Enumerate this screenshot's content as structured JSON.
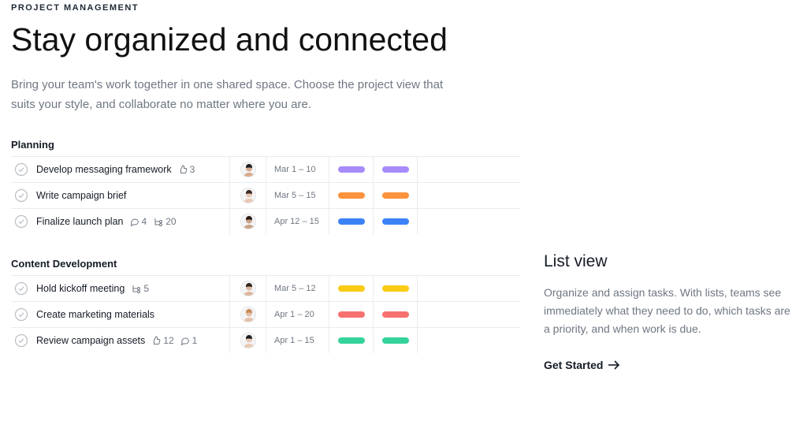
{
  "eyebrow": "PROJECT MANAGEMENT",
  "title": "Stay organized and connected",
  "subtitle": "Bring your team's work together in one shared space. Choose the project view that suits your style, and collaborate no matter where you are.",
  "sections": [
    {
      "header": "Planning",
      "rows": [
        {
          "name": "Develop messaging framework",
          "metas": [
            {
              "icon": "like",
              "count": "3"
            }
          ],
          "avatar": {
            "skin": "#d9a98c",
            "hair": "#1c1c1c"
          },
          "dates": "Mar 1 – 10",
          "pill": "#a78bfa"
        },
        {
          "name": "Write campaign brief",
          "metas": [],
          "avatar": {
            "skin": "#e8c7b3",
            "hair": "#3b2a20"
          },
          "dates": "Mar 5 – 15",
          "pill": "#fb923c"
        },
        {
          "name": "Finalize launch plan",
          "metas": [
            {
              "icon": "comment",
              "count": "4"
            },
            {
              "icon": "subtask",
              "count": "20"
            }
          ],
          "avatar": {
            "skin": "#caa488",
            "hair": "#2a1a12"
          },
          "dates": "Apr 12 – 15",
          "pill": "#3b82f6"
        }
      ]
    },
    {
      "header": "Content Development",
      "rows": [
        {
          "name": "Hold kickoff meeting",
          "metas": [
            {
              "icon": "subtask",
              "count": "5"
            }
          ],
          "avatar": {
            "skin": "#dcb79d",
            "hair": "#30251d"
          },
          "dates": "Mar 5 – 12",
          "pill": "#facc15"
        },
        {
          "name": "Create marketing materials",
          "metas": [],
          "avatar": {
            "skin": "#e4bfa7",
            "hair": "#c78a55"
          },
          "dates": "Apr 1 – 20",
          "pill": "#f87171"
        },
        {
          "name": "Review campaign assets",
          "metas": [
            {
              "icon": "like",
              "count": "12"
            },
            {
              "icon": "comment",
              "count": "1"
            }
          ],
          "avatar": {
            "skin": "#e7c9b5",
            "hair": "#1e1e1e"
          },
          "dates": "Apr 1 – 15",
          "pill": "#34d399"
        }
      ]
    }
  ],
  "side": {
    "title": "List view",
    "body": "Organize and assign tasks. With lists, teams see immediately what they need to do, which tasks are a priority, and when work is due.",
    "cta": "Get Started"
  }
}
